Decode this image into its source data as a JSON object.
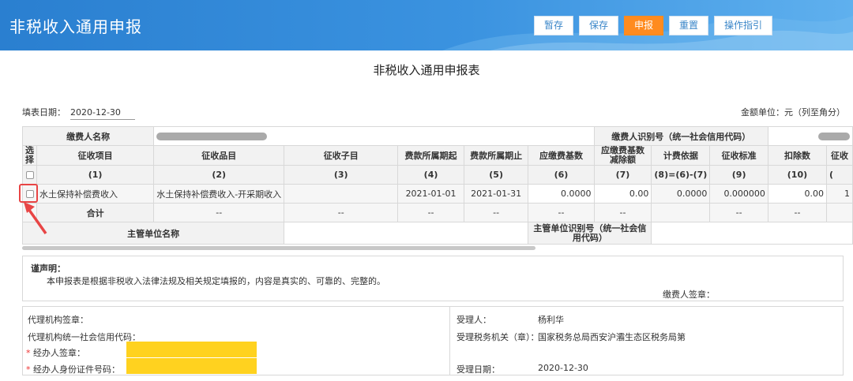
{
  "header": {
    "title": "非税收入通用申报",
    "buttons": {
      "temp_save": "暂存",
      "save": "保存",
      "declare": "申报",
      "reset": "重置",
      "guide": "操作指引"
    }
  },
  "form": {
    "title": "非税收入通用申报表",
    "fill_date_label": "填表日期：",
    "fill_date": "2020-12-30",
    "unit": "金额单位：元（列至角分）"
  },
  "table": {
    "payer_name_label": "缴费人名称",
    "payer_id_label": "缴费人识别号（统一社会信用代码）",
    "headers": {
      "select": "选择",
      "item": "征收项目",
      "category": "征收品目",
      "subitem": "征收子目",
      "period_start": "费款所属期起",
      "period_end": "费款所属期止",
      "base": "应缴费基数",
      "base_deduct": "应缴费基数减除额",
      "basis": "计费依据",
      "standard": "征收标准",
      "deduction": "扣除数",
      "next": "征收"
    },
    "index_row": [
      "(1)",
      "(2)",
      "(3)",
      "(4)",
      "(5)",
      "(6)",
      "(7)",
      "(8)=(6)-(7)",
      "(9)",
      "(10)",
      "("
    ],
    "row": {
      "item": "水土保持补偿费收入",
      "category": "水土保持补偿费收入-开采期收入",
      "subitem": "",
      "period_start": "2021-01-01",
      "period_end": "2021-01-31",
      "base": "0.0000",
      "base_deduct": "0.00",
      "basis": "0.0000",
      "standard": "0.000000",
      "deduction": "0.00",
      "next": "1"
    },
    "total_label": "合计",
    "dash": "--",
    "supervisor_name_label": "主管单位名称",
    "supervisor_id_label": "主管单位识别号（统一社会信用代码）"
  },
  "declaration": {
    "heading": "谨声明：",
    "text": "本申报表是根据非税收入法律法规及相关规定填报的，内容是真实的、可靠的、完整的。",
    "payer_sign": "缴费人签章："
  },
  "bottom": {
    "agent_seal": "代理机构签章：",
    "agent_credit": "代理机构统一社会信用代码：",
    "star": "*",
    "handler_sign": "经办人签章：",
    "handler_id": "经办人身份证件号码：",
    "acceptor_label": "受理人：",
    "acceptor": "杨利华",
    "tax_office_label": "受理税务机关（章）：",
    "tax_office": "国家税务总局西安沪灞生态区税务局第",
    "accept_date_label": "受理日期：",
    "accept_date": "2020-12-30"
  },
  "colors": {
    "header_blue": "#2a7fd0",
    "declare_orange": "#ff8b1f",
    "highlight_yellow": "#ffd21f",
    "annotation_red": "#e84545"
  }
}
